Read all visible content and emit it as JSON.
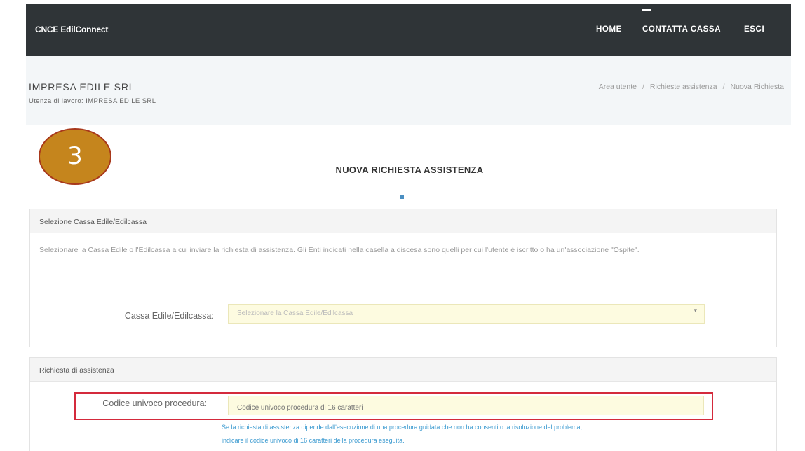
{
  "nav": {
    "brand": "CNCE EdilConnect",
    "items": [
      {
        "label": "HOME"
      },
      {
        "label": "CONTATTA CASSA"
      },
      {
        "label": "ESCI"
      }
    ]
  },
  "header": {
    "company": "IMPRESA EDILE SRL",
    "subtitle": "Utenza di lavoro: IMPRESA EDILE SRL",
    "breadcrumb": [
      "Area utente",
      "Richieste assistenza",
      "Nuova Richiesta"
    ]
  },
  "step": {
    "number": "3"
  },
  "page": {
    "title": "NUOVA RICHIESTA ASSISTENZA"
  },
  "panel_cassa": {
    "heading": "Selezione Cassa Edile/Edilcassa",
    "description": "Selezionare la Cassa Edile o l'Edilcassa a cui inviare la richiesta di assistenza. Gli Enti indicati nella casella a discesa sono quelli per cui l'utente è iscritto o ha un'associazione \"Ospite\".",
    "field_label": "Cassa Edile/Edilcassa:",
    "select_placeholder": "Selezionare la Cassa Edile/Edilcassa"
  },
  "panel_richiesta": {
    "heading": "Richiesta di assistenza",
    "codice_label": "Codice univoco procedura:",
    "codice_placeholder": "Codice univoco procedura di 16 caratteri",
    "help_line1": "Se la richiesta di assistenza dipende dall'esecuzione di una procedura guidata che non ha consentito la risoluzione del problema,",
    "help_line2": "indicare il codice univoco di 16 caratteri della procedura eseguita."
  },
  "colors": {
    "nav_bg": "#2f3437",
    "step_circle": "#c5851d",
    "highlight_border": "#d42a3c",
    "input_bg": "#fdfbe0",
    "help_text": "#3b9ad0"
  }
}
